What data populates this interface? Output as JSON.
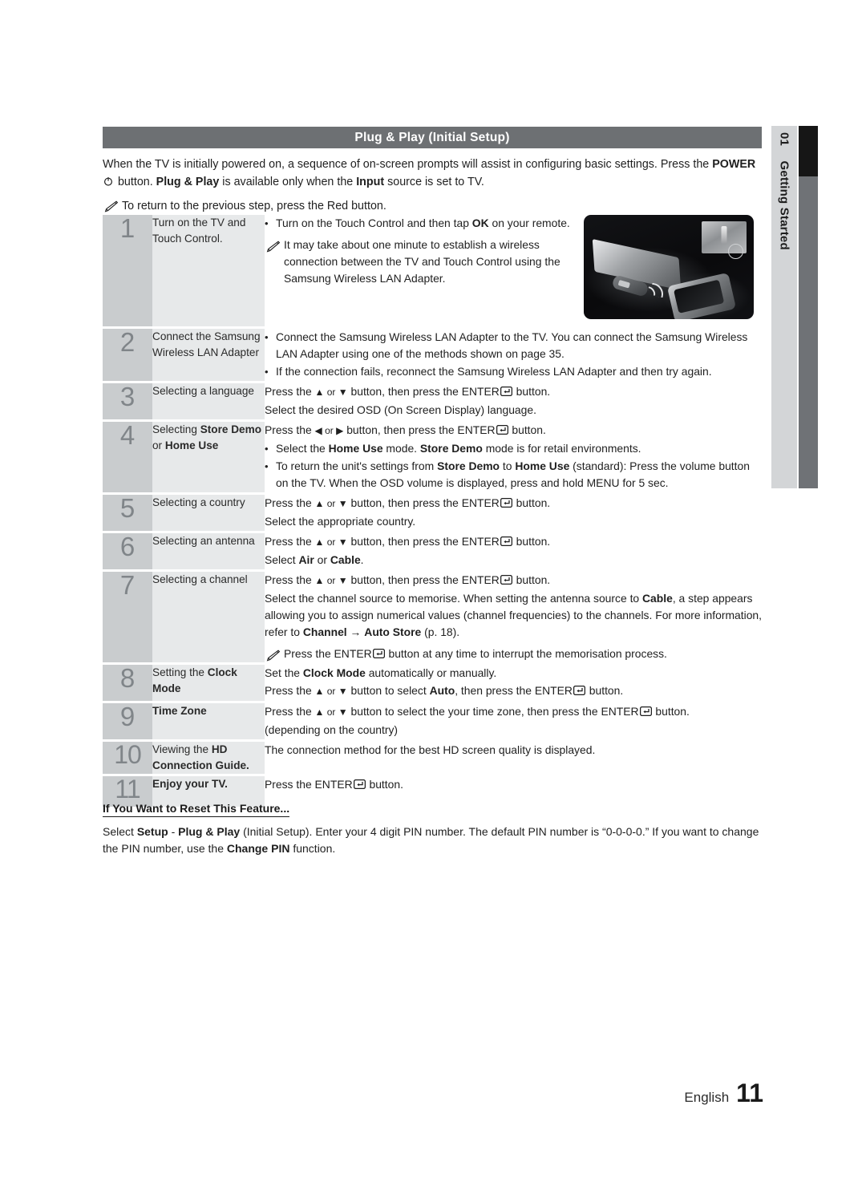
{
  "header": {
    "title": "Plug & Play (Initial Setup)"
  },
  "side_tab": {
    "number": "01",
    "label": "Getting Started"
  },
  "intro": {
    "line1_a": "When the TV is initially powered on, a sequence of on-screen prompts will assist in configuring basic settings. Press the ",
    "power_label": "POWER",
    "line1_b": " button. ",
    "plug_play": "Plug & Play",
    "line1_c": " is available only when the ",
    "input": "Input",
    "line1_d": " source is set to TV.",
    "note": "To return to the previous step, press the Red button."
  },
  "steps": [
    {
      "num": "1",
      "label": "Turn on the TV and Touch Control.",
      "bullets": [
        "Turn on the Touch Control and then tap OK on your remote."
      ],
      "bullet_bold": "OK",
      "note": "It may take about one minute to establish a wireless connection between the TV and Touch Control using the Samsung Wireless LAN Adapter.",
      "has_thumbnail": true
    },
    {
      "num": "2",
      "label": "Connect the Samsung Wireless LAN Adapter",
      "bullets": [
        "Connect the Samsung Wireless LAN Adapter to the TV. You can connect the Samsung Wireless LAN Adapter using one of the methods shown on page 35.",
        "If the connection fails, reconnect the Samsung Wireless LAN Adapter and then try again."
      ]
    },
    {
      "num": "3",
      "label_plain": "Selecting a language",
      "line1_pre": "Press the ",
      "line1_keys": "▲ or ▼",
      "line1_mid": " button, then press the ENTER",
      "line1_post": " button.",
      "line2": "Select the desired OSD (On Screen Display) language."
    },
    {
      "num": "4",
      "label_pre": "Selecting ",
      "label_b1": "Store Demo",
      "label_mid": " or ",
      "label_b2": "Home Use",
      "line1_pre": "Press the ",
      "line1_keys": "◀ or ▶",
      "line1_mid": " button, then press the ENTER",
      "line1_post": " button.",
      "bullet1": "Select the Home Use mode. Store Demo mode is for retail environments.",
      "bullet2": "To return the unit's settings from Store Demo to Home Use (standard): Press the volume button on the TV. When the OSD volume is displayed, press and hold MENU for 5 sec."
    },
    {
      "num": "5",
      "label_plain": "Selecting a country",
      "line1_pre": "Press the ",
      "line1_keys": "▲ or ▼",
      "line1_mid": " button, then press the ENTER",
      "line1_post": " button.",
      "line2": "Select the appropriate country."
    },
    {
      "num": "6",
      "label_plain": "Selecting an antenna",
      "line1_pre": "Press the ",
      "line1_keys": "▲ or ▼",
      "line1_mid": " button, then press the ENTER",
      "line1_post": " button.",
      "line2_pre": "Select ",
      "line2_b1": "Air",
      "line2_mid": " or ",
      "line2_b2": "Cable",
      "line2_post": "."
    },
    {
      "num": "7",
      "label_plain": "Selecting a channel",
      "line1_pre": "Press the ",
      "line1_keys": "▲ or ▼",
      "line1_mid": " button, then press the ENTER",
      "line1_post": " button.",
      "para": "Select the channel source to memorise. When setting the antenna source to Cable, a step appears allowing you to assign numerical values (channel frequencies) to the channels. For more information, refer to Channel → Auto Store (p. 18).",
      "note": "Press the ENTER button at any time to interrupt the memorisation process."
    },
    {
      "num": "8",
      "label_pre": "Setting the ",
      "label_b1": "Clock Mode",
      "line1": "Set the Clock Mode automatically or manually.",
      "line2_pre": "Press the ",
      "line2_keys": "▲ or ▼",
      "line2_mid": " button to select ",
      "line2_b": "Auto",
      "line2_mid2": ", then press the ENTER",
      "line2_post": " button."
    },
    {
      "num": "9",
      "label_b": "Time Zone",
      "line1_pre": "Press the ",
      "line1_keys": "▲ or ▼",
      "line1_mid": " button to select the your time zone, then press the ENTER",
      "line1_post": " button.",
      "line2": "(depending on the country)"
    },
    {
      "num": "10",
      "label_pre": "Viewing the ",
      "label_b1": "HD Connection Guide.",
      "line1": "The connection method for the best HD screen quality is displayed."
    },
    {
      "num": "11",
      "label_b": "Enjoy your TV.",
      "line1_pre": "Press the ENTER",
      "line1_post": " button."
    }
  ],
  "reset": {
    "title": "If You Want to Reset This Feature...",
    "body_pre": "Select ",
    "body_b1": "Setup",
    "body_mid1": " - ",
    "body_b2": "Plug & Play",
    "body_mid2": " (Initial Setup). Enter your 4 digit PIN number. The default PIN number is “0-0-0-0.” If you want to change the PIN number, use the ",
    "body_b3": "Change PIN",
    "body_post": " function."
  },
  "footer": {
    "language": "English",
    "page": "11"
  }
}
